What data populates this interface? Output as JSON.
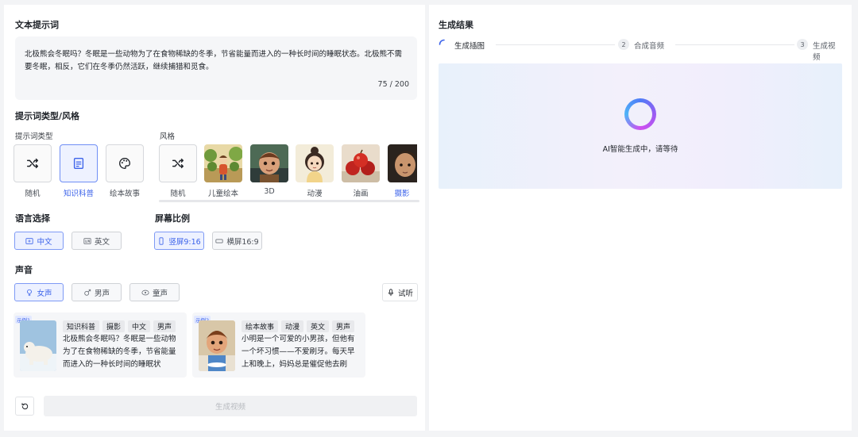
{
  "left": {
    "prompt_title": "文本提示词",
    "prompt_text": "北极熊会冬眠吗？冬眠是一些动物为了在食物稀缺的冬季，节省能量而进入的一种长时间的睡眠状态。北极熊不需要冬眠，相反，它们在冬季仍然活跃，继续捕猎和觅食。",
    "prompt_counter": "75 / 200",
    "type_style_title": "提示词类型/风格",
    "type_label": "提示词类型",
    "style_label": "风格",
    "types": [
      {
        "label": "随机",
        "icon": "shuffle-icon",
        "selected": false
      },
      {
        "label": "知识科普",
        "icon": "document-icon",
        "selected": true
      },
      {
        "label": "绘本故事",
        "icon": "palette-icon",
        "selected": false
      }
    ],
    "styles": [
      {
        "label": "随机",
        "icon": "shuffle-icon",
        "selected": false
      },
      {
        "label": "儿童绘本",
        "selected": false
      },
      {
        "label": "3D",
        "selected": false
      },
      {
        "label": "动漫",
        "selected": false
      },
      {
        "label": "油画",
        "selected": false
      },
      {
        "label": "摄影",
        "selected": true
      }
    ],
    "language_title": "语言选择",
    "languages": [
      {
        "label": "中文",
        "icon": "chinese-icon",
        "selected": true
      },
      {
        "label": "英文",
        "icon": "english-icon",
        "selected": false
      }
    ],
    "ratio_title": "屏幕比例",
    "ratios": [
      {
        "label": "竖屏9:16",
        "icon": "portrait-icon",
        "selected": true
      },
      {
        "label": "横屏16:9",
        "icon": "landscape-icon",
        "selected": false
      }
    ],
    "voice_title": "声音",
    "voices": [
      {
        "label": "女声",
        "icon": "female-icon",
        "selected": true
      },
      {
        "label": "男声",
        "icon": "male-icon",
        "selected": false
      },
      {
        "label": "童声",
        "icon": "child-icon",
        "selected": false
      }
    ],
    "listen_label": "试听",
    "examples": [
      {
        "badge": "示例1",
        "tags": [
          "知识科普",
          "摄影",
          "中文",
          "男声"
        ],
        "text": "北极熊会冬眠吗？冬眠是一些动物为了在食物稀缺的冬季，节省能量而进入的一种长时间的睡眠状态。..."
      },
      {
        "badge": "示例2",
        "tags": [
          "绘本故事",
          "动漫",
          "英文",
          "男声"
        ],
        "text": "小明是一个可爱的小男孩，但他有一个坏习惯——不爱刷牙。每天早上和晚上，妈妈总是催促他去刷牙，..."
      }
    ],
    "generate_label": "生成视频"
  },
  "right": {
    "title": "生成结果",
    "steps": [
      {
        "num": "",
        "label": "生成插图",
        "active": true
      },
      {
        "num": "2",
        "label": "合成音频",
        "active": false
      },
      {
        "num": "3",
        "label": "生成视频",
        "active": false
      }
    ],
    "status_text": "AI智能生成中，请等待"
  },
  "colors": {
    "accent": "#3c63ea",
    "selected_bg": "#edf1ff",
    "panel_bg": "#ffffff",
    "page_bg": "#f3f4f6"
  }
}
